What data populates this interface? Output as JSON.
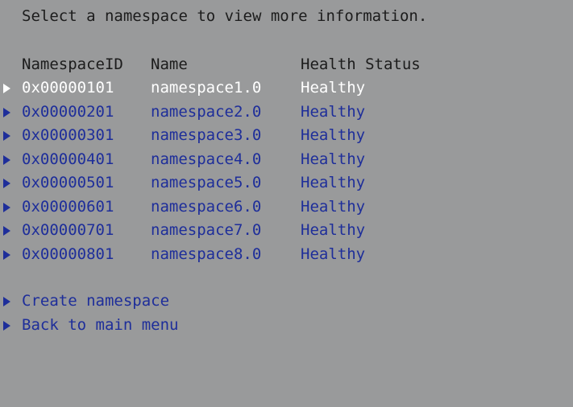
{
  "instruction": "Select a namespace to view more information.",
  "columns": {
    "id": "NamespaceID",
    "name": "Name",
    "health": "Health Status"
  },
  "namespaces": [
    {
      "id": "0x00000101",
      "name": "namespace1.0",
      "health": "Healthy",
      "selected": true
    },
    {
      "id": "0x00000201",
      "name": "namespace2.0",
      "health": "Healthy"
    },
    {
      "id": "0x00000301",
      "name": "namespace3.0",
      "health": "Healthy"
    },
    {
      "id": "0x00000401",
      "name": "namespace4.0",
      "health": "Healthy"
    },
    {
      "id": "0x00000501",
      "name": "namespace5.0",
      "health": "Healthy"
    },
    {
      "id": "0x00000601",
      "name": "namespace6.0",
      "health": "Healthy"
    },
    {
      "id": "0x00000701",
      "name": "namespace7.0",
      "health": "Healthy"
    },
    {
      "id": "0x00000801",
      "name": "namespace8.0",
      "health": "Healthy"
    }
  ],
  "actions": {
    "create": "Create namespace",
    "back": "Back to main menu"
  },
  "colors": {
    "background": "#999a9b",
    "link": "#1e2e9a",
    "selected": "#ffffff",
    "text": "#1c1c1c"
  },
  "icons": {
    "row_marker": "triangle-right-icon"
  }
}
